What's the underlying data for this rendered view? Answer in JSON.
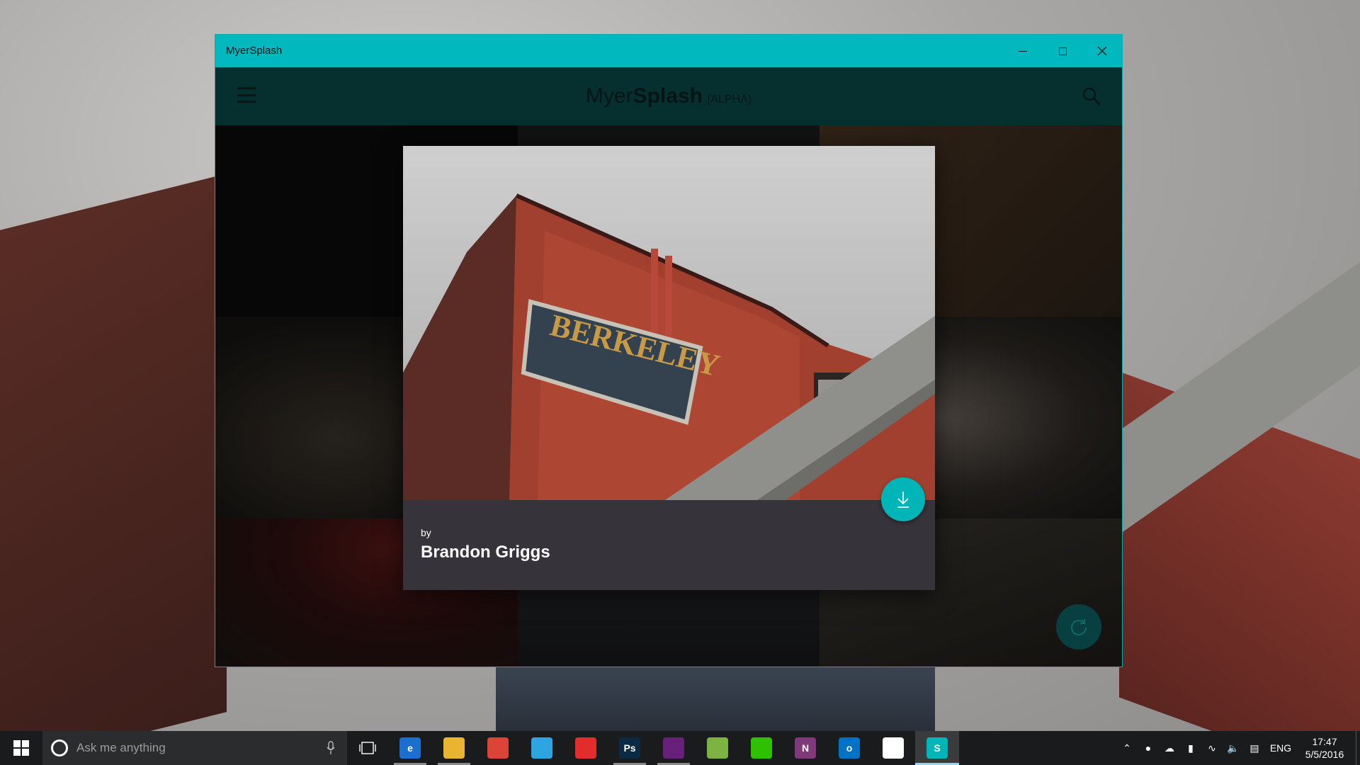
{
  "window": {
    "title": "MyerSplash",
    "accent_color": "#02b8bf"
  },
  "header": {
    "brand_part1": "Myer",
    "brand_part2": "Splash",
    "brand_part3": "(ALPHA)",
    "icons": [
      "hamburger-menu-icon",
      "search-icon"
    ]
  },
  "detail": {
    "by_label": "by",
    "author": "Brandon Griggs",
    "photo_sign_text": "BERKELEY",
    "download_icon": "download-arrow-icon",
    "download_color": "#00b5b8"
  },
  "fab": {
    "icon": "refresh-icon"
  },
  "taskbar": {
    "search_placeholder": "Ask me anything",
    "apps": [
      {
        "name": "Microsoft Edge",
        "glyph": "e",
        "color": "#1b6fd1",
        "running": true,
        "active": false
      },
      {
        "name": "File Explorer",
        "glyph": "",
        "color": "#e9b531",
        "running": true,
        "active": false
      },
      {
        "name": "Google Chrome",
        "glyph": "",
        "color": "#db4437",
        "running": false,
        "active": false
      },
      {
        "name": "Telegram",
        "glyph": "",
        "color": "#2ca5e0",
        "running": false,
        "active": false
      },
      {
        "name": "NetEase Music",
        "glyph": "",
        "color": "#e32c2c",
        "running": false,
        "active": false
      },
      {
        "name": "Photoshop",
        "glyph": "Ps",
        "color": "#0b2a43",
        "running": true,
        "active": false
      },
      {
        "name": "Visual Studio",
        "glyph": "",
        "color": "#68217a",
        "running": true,
        "active": false
      },
      {
        "name": "Android Studio",
        "glyph": "",
        "color": "#7cb342",
        "running": false,
        "active": false
      },
      {
        "name": "WeChat",
        "glyph": "",
        "color": "#2dc100",
        "running": false,
        "active": false
      },
      {
        "name": "OneNote",
        "glyph": "N",
        "color": "#80397b",
        "running": false,
        "active": false
      },
      {
        "name": "Outlook",
        "glyph": "o",
        "color": "#0072c6",
        "running": false,
        "active": false
      },
      {
        "name": "Tips",
        "glyph": "",
        "color": "#ffffff",
        "running": false,
        "active": false
      },
      {
        "name": "MyerSplash",
        "glyph": "S",
        "color": "#00b5b8",
        "running": true,
        "active": true
      }
    ],
    "tray": {
      "language": "ENG",
      "time": "17:47",
      "date": "5/5/2016"
    }
  }
}
